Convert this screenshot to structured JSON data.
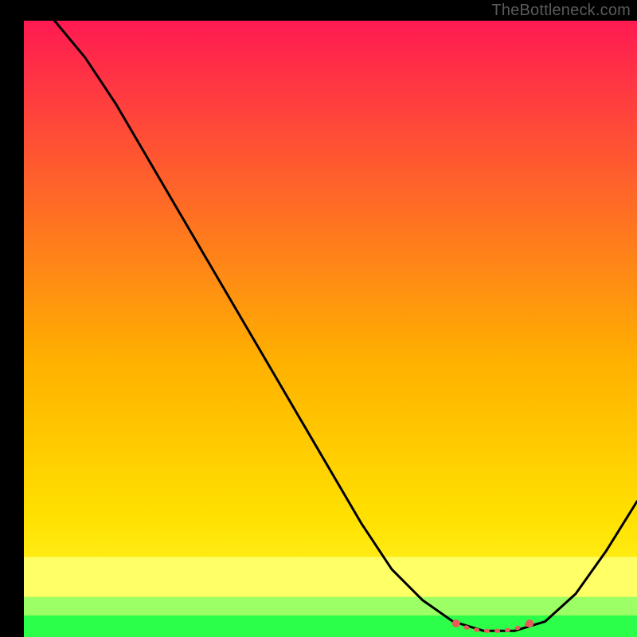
{
  "watermark": "TheBottleneck.com",
  "colors": {
    "top": "#ff1a52",
    "mid": "#ffd400",
    "band_yellow": "#ffff66",
    "band_green_light": "#9cff66",
    "band_green": "#2bff4a",
    "curve": "#000000",
    "marker": "#e85a5a",
    "frame": "#000000"
  },
  "chart_data": {
    "type": "line",
    "title": "",
    "xlabel": "",
    "ylabel": "",
    "xlim": [
      0,
      100
    ],
    "ylim": [
      0,
      100
    ],
    "series": [
      {
        "name": "bottleneck-curve",
        "x": [
          5,
          10,
          15,
          20,
          25,
          30,
          35,
          40,
          45,
          50,
          55,
          60,
          65,
          70,
          75,
          80,
          85,
          90,
          95,
          100
        ],
        "y": [
          100,
          94,
          86.5,
          78,
          69.5,
          61,
          52.5,
          44,
          35.5,
          27,
          18.5,
          11,
          6,
          2.5,
          1,
          1,
          2.5,
          7,
          14,
          22
        ]
      }
    ],
    "flat_region_x": [
      70,
      83
    ],
    "markers": {
      "name": "optimal-range",
      "x": [
        70.5,
        72,
        73.5,
        75,
        76.5,
        78,
        79.5,
        81,
        82.5
      ],
      "y": [
        2.2,
        1.6,
        1.2,
        1.0,
        1.0,
        1.0,
        1.2,
        1.6,
        2.2
      ]
    },
    "bands_y": [
      {
        "name": "pale-yellow",
        "from": 13,
        "to": 6.5
      },
      {
        "name": "green-light",
        "from": 6.5,
        "to": 3.5
      },
      {
        "name": "green",
        "from": 3.5,
        "to": 0
      }
    ]
  }
}
